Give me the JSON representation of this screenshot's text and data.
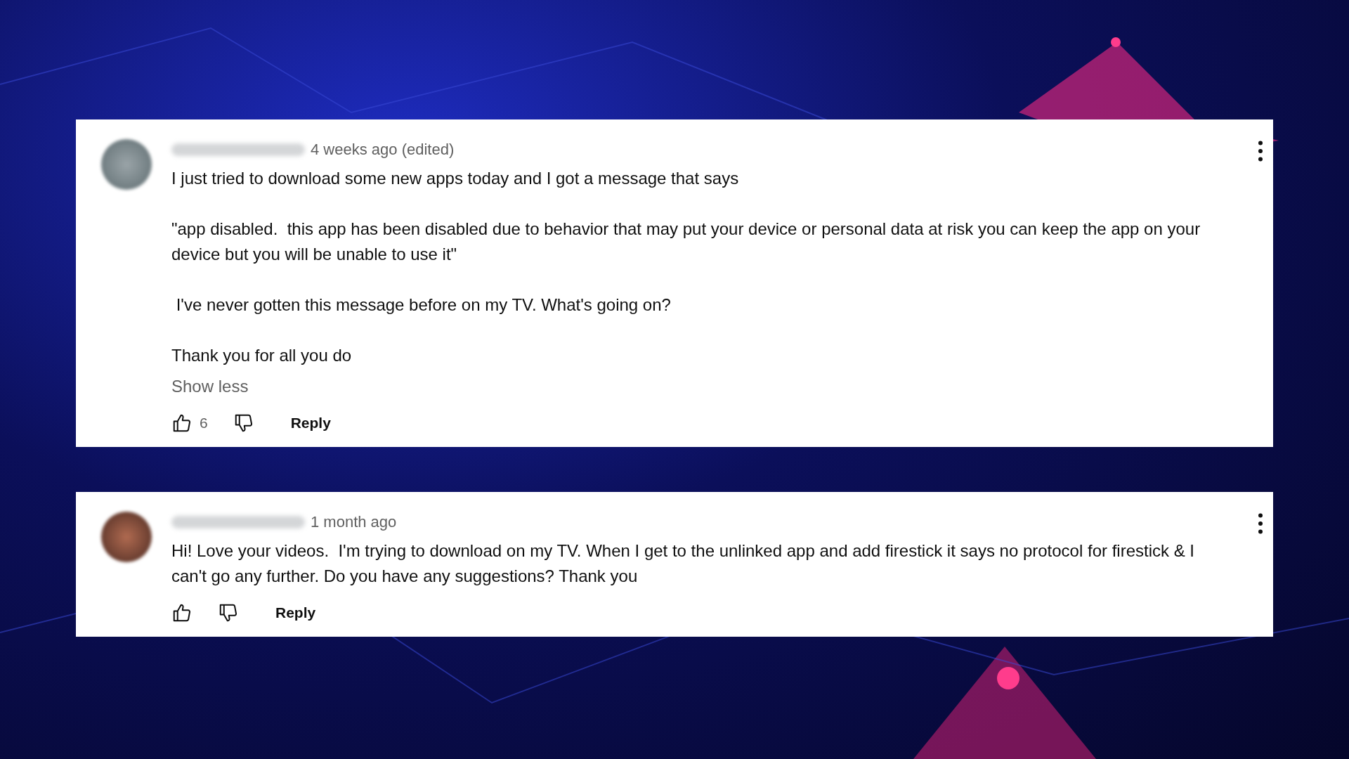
{
  "comments": [
    {
      "time": "4 weeks ago (edited)",
      "paragraphs": [
        "I just tried to download some new apps today and I got a message that says",
        "\"app disabled.  this app has been disabled due to behavior that may put your device or personal data at risk you can keep the app on your device but you will be unable to use it\"",
        " I've never gotten this message before on my TV. What's going on?",
        "Thank you for all you do"
      ],
      "toggle": "Show less",
      "likes": "6",
      "reply": "Reply"
    },
    {
      "time": "1 month ago",
      "paragraphs": [
        "Hi! Love your videos.  I'm trying to download on my TV. When I get to the unlinked app and add firestick it says no protocol for firestick & I can't go any further. Do you have any suggestions? Thank you"
      ],
      "reply": "Reply"
    }
  ]
}
